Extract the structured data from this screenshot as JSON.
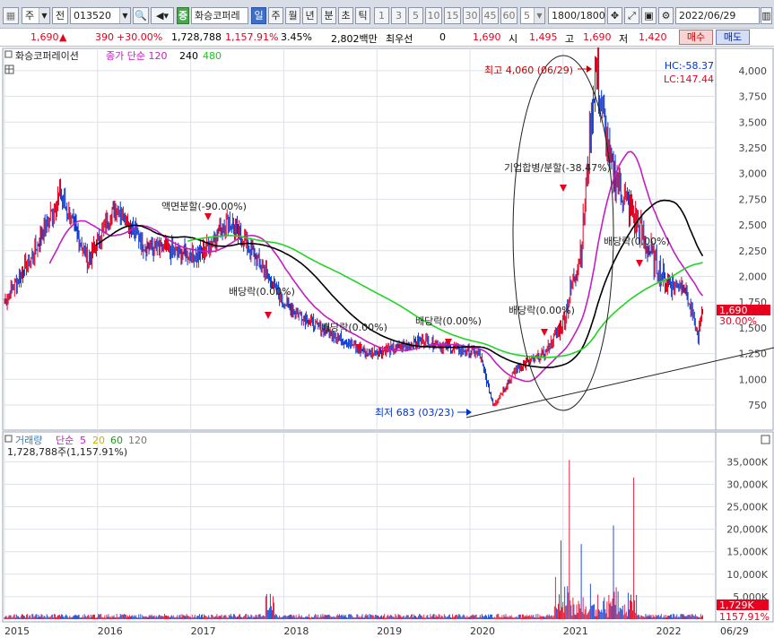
{
  "toolbar": {
    "market": "주",
    "type": "전",
    "code": "013520",
    "stock_name": "화승코퍼레",
    "periods": [
      "일",
      "주",
      "월",
      "년",
      "분",
      "초",
      "틱"
    ],
    "selected_period": "일",
    "numbers": [
      "1",
      "3",
      "5",
      "10",
      "15",
      "30",
      "45",
      "60"
    ],
    "count": "5",
    "range": "1800",
    "range_total": "/1800",
    "date": "2022/06/29"
  },
  "quote": {
    "price": "1,690",
    "change": "390",
    "change_pct": "+30.00%",
    "volume": "1,728,788",
    "volume_pct": "1,157.91%",
    "turnover": "3.45%",
    "amount": "2,802백만",
    "pref_label": "최우선",
    "pref_value": "0",
    "price2": "1,690",
    "open_label": "시",
    "open": "1,495",
    "high_label": "고",
    "high": "1,690",
    "low_label": "저",
    "low": "1,420",
    "buy": "매수",
    "sell": "매도"
  },
  "price_panel": {
    "legend_name": "화승코퍼레이션",
    "legend_ma": "종가 단순",
    "ma1": "120",
    "ma2": "240",
    "ma3": "480",
    "lc": "LC:147.44",
    "hc": "HC:-58.37",
    "current_tag": "1,690",
    "current_pct": "30.00%",
    "annotations": {
      "high": "최고 4,060 (06/29)",
      "low": "최저 683 (03/23)",
      "split": "액면분할(-90.00%)",
      "merger": "기업합병/분할(-38.47%)",
      "div1": "배당락(0.00%)",
      "div2": "배당락(0.00%)",
      "div3": "배당락(0.00%)",
      "div4": "배당락(0.00%)",
      "div5": "배당락(0.00%)"
    }
  },
  "volume_panel": {
    "legend_name": "거래량",
    "legend_ma": "단순",
    "ma1": "5",
    "ma2": "20",
    "ma3": "60",
    "ma4": "120",
    "info": "1,728,788주(1,157.91%)",
    "current_tag": "1,729K",
    "current_pct": "1157.91%"
  },
  "colors": {
    "up": "#e8001f",
    "down": "#0033cc",
    "ma120": "#c21fc2",
    "ma240": "#000000",
    "ma480": "#22d422"
  },
  "chart_data": [
    {
      "type": "line",
      "y_axis_ticks": [
        "750",
        "1,000",
        "1,250",
        "1,500",
        "1,750",
        "2,000",
        "2,250",
        "2,500",
        "2,750",
        "3,000",
        "3,250",
        "3,500",
        "3,750",
        "4,000"
      ],
      "x_axis_ticks": [
        "2015",
        "2016",
        "2017",
        "2018",
        "2019",
        "2020",
        "2021",
        "2022",
        "06/29"
      ],
      "ylim": [
        600,
        4150
      ],
      "series": [
        {
          "x": [
            2015.0,
            2015.3,
            2015.6,
            2015.9,
            2016.2,
            2016.5,
            2016.8,
            2017.1,
            2017.4,
            2017.7,
            2018.0,
            2018.3,
            2018.6,
            2018.9,
            2019.2,
            2019.5,
            2019.8,
            2020.1,
            2020.25,
            2020.5,
            2020.8,
            2021.0,
            2021.2,
            2021.35,
            2021.5,
            2021.7,
            2021.9,
            2022.1,
            2022.3,
            2022.45,
            2022.5
          ],
          "values": [
            1750,
            2200,
            2800,
            2150,
            2700,
            2300,
            2250,
            2200,
            2550,
            2200,
            1750,
            1550,
            1400,
            1250,
            1300,
            1380,
            1300,
            1250,
            750,
            1100,
            1250,
            1550,
            2300,
            4060,
            3100,
            2700,
            2300,
            1950,
            1900,
            1420,
            1690
          ]
        }
      ]
    },
    {
      "type": "bar",
      "y_axis_ticks": [
        "5,000K",
        "10,000K",
        "15,000K",
        "20,000K",
        "25,000K",
        "30,000K",
        "35,000K"
      ],
      "ylim": [
        0,
        38000000
      ]
    }
  ]
}
